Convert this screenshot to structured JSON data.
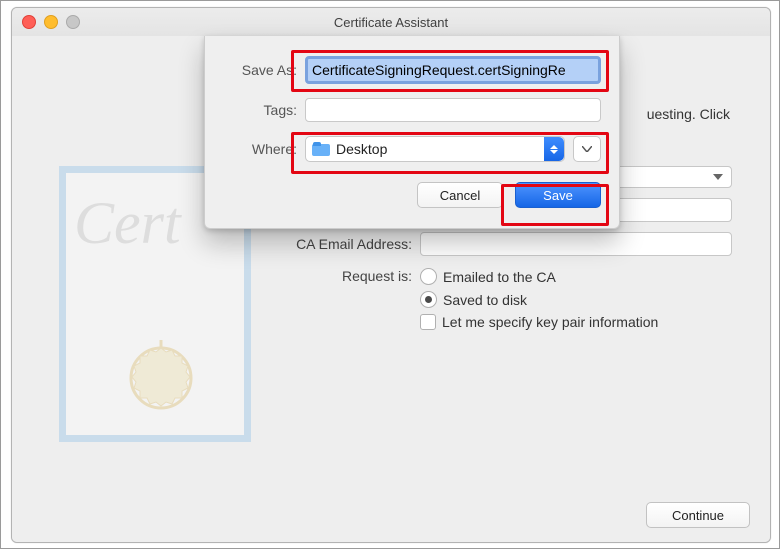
{
  "window": {
    "title": "Certificate Assistant"
  },
  "background_hint": "uesting. Click",
  "lower_form": {
    "ca_email_label": "CA Email Address:",
    "request_label": "Request is:",
    "radio_emailed": "Emailed to the CA",
    "radio_saved": "Saved to disk",
    "chk_keypair": "Let me specify key pair information"
  },
  "sheet": {
    "saveas_label": "Save As:",
    "saveas_value": "CertificateSigningRequest.certSigningRe",
    "tags_label": "Tags:",
    "tags_value": "",
    "where_label": "Where:",
    "where_value": "Desktop",
    "cancel": "Cancel",
    "save": "Save"
  },
  "continue_label": "Continue"
}
